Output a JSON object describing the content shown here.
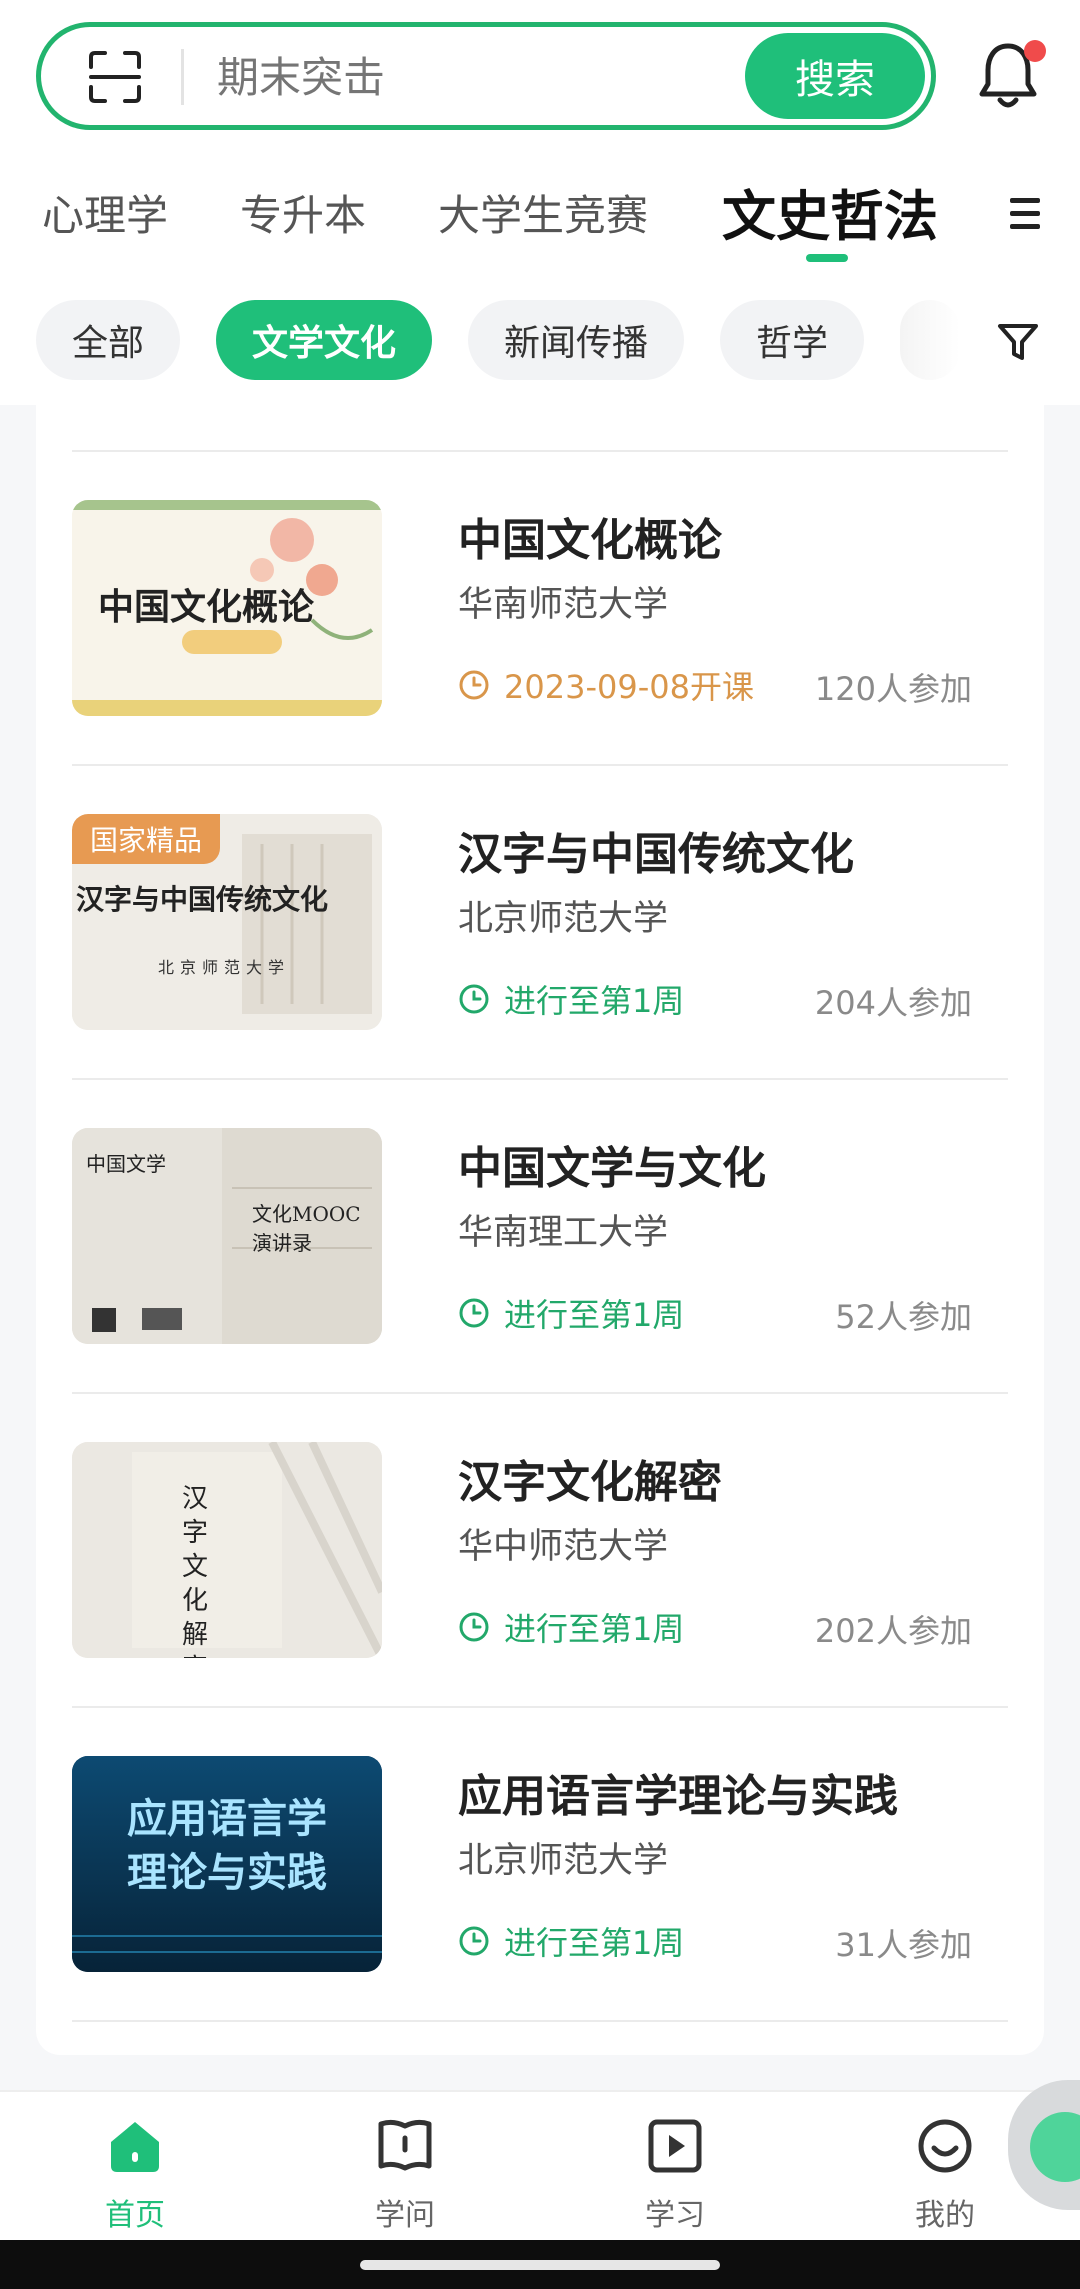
{
  "search": {
    "placeholder": "期末突击",
    "button_label": "搜索"
  },
  "tabs": [
    {
      "label": "心理学"
    },
    {
      "label": "专升本"
    },
    {
      "label": "大学生竞赛"
    },
    {
      "label": "文史哲法",
      "active": true
    }
  ],
  "chips": [
    {
      "label": "全部"
    },
    {
      "label": "文学文化",
      "active": true
    },
    {
      "label": "新闻传播"
    },
    {
      "label": "哲学"
    }
  ],
  "courses": [
    {
      "title": "中国文化概论",
      "school": "华南师范大学",
      "status": "2023-09-08开课",
      "status_type": "upcoming",
      "count": "120人参加",
      "cover_text": "中国文化概论"
    },
    {
      "title": "汉字与中国传统文化",
      "school": "北京师范大学",
      "status": "进行至第1周",
      "status_type": "ongoing",
      "count": "204人参加",
      "badge": "国家精品",
      "cover_text": "汉字与中国传统文化",
      "cover_subtext": "北京师范大学"
    },
    {
      "title": "中国文学与文化",
      "school": "华南理工大学",
      "status": "进行至第1周",
      "status_type": "ongoing",
      "count": "52人参加",
      "cover_text": "中国文学",
      "cover_subtext": "文化MOOC 演讲录"
    },
    {
      "title": "汉字文化解密",
      "school": "华中师范大学",
      "status": "进行至第1周",
      "status_type": "ongoing",
      "count": "202人参加",
      "cover_text": "汉字文化解密"
    },
    {
      "title": "应用语言学理论与实践",
      "school": "北京师范大学",
      "status": "进行至第1周",
      "status_type": "ongoing",
      "count": "31人参加",
      "cover_text": "应用语言学",
      "cover_subtext": "理论与实践"
    }
  ],
  "nav": [
    {
      "label": "首页",
      "icon": "home-icon",
      "active": true
    },
    {
      "label": "学问",
      "icon": "book-icon"
    },
    {
      "label": "学习",
      "icon": "play-icon"
    },
    {
      "label": "我的",
      "icon": "smile-icon"
    }
  ],
  "colors": {
    "accent": "#1fbf7a",
    "upcoming": "#d9964a",
    "badge": "#e79a52",
    "notification": "#f04b4b"
  }
}
